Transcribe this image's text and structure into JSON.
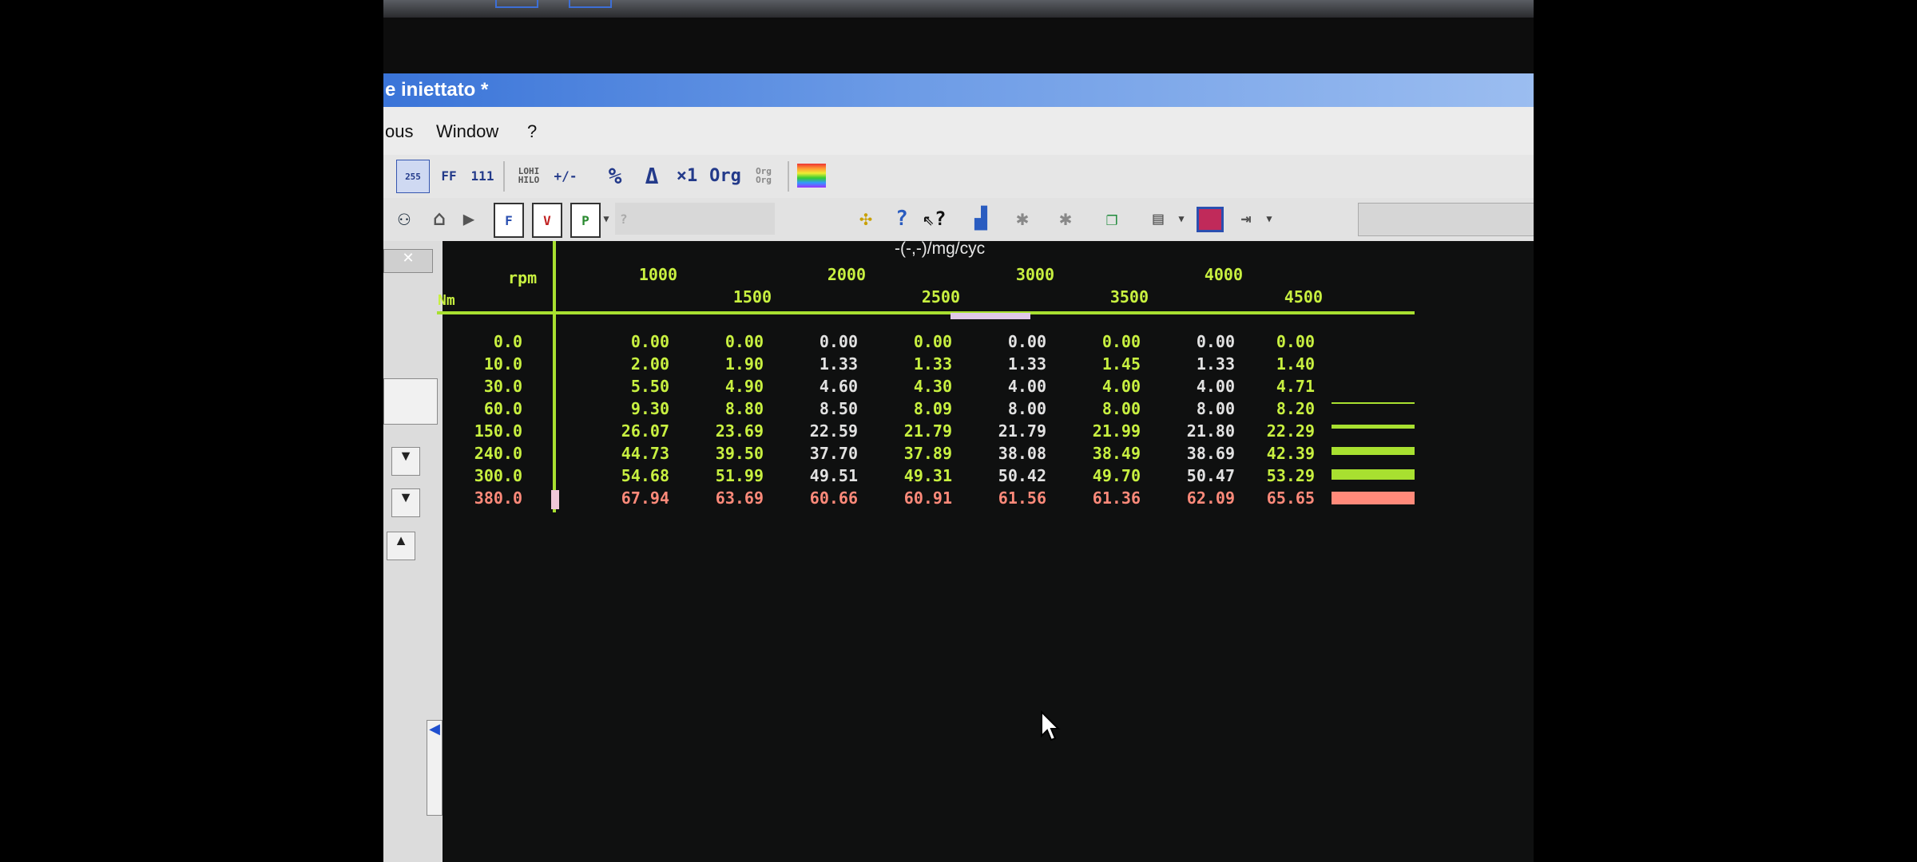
{
  "window": {
    "title": "e iniettato *"
  },
  "menu": {
    "items": [
      "ous",
      "Window",
      "?"
    ]
  },
  "toolbar1": {
    "buttons": [
      "255",
      "FF",
      "111",
      "LOHI HILO",
      "+/-",
      "%",
      "Δ",
      "×1",
      "Org",
      "Org Org",
      "rainbow"
    ]
  },
  "toolbar2": {
    "dropdown_placeholder": "?"
  },
  "table": {
    "unit": "-(-,-)/mg/cyc",
    "x_axis_label": "rpm",
    "y_axis_label": "Nm",
    "rpm": [
      "1000",
      "1500",
      "2000",
      "2500",
      "3000",
      "3500",
      "4000",
      "4500"
    ],
    "nm": [
      "0.0",
      "10.0",
      "30.0",
      "60.0",
      "150.0",
      "240.0",
      "300.0",
      "380.0"
    ],
    "rows": [
      [
        "0.00",
        "0.00",
        "0.00",
        "0.00",
        "0.00",
        "0.00",
        "0.00",
        "0.00"
      ],
      [
        "2.00",
        "1.90",
        "1.33",
        "1.33",
        "1.33",
        "1.45",
        "1.33",
        "1.40"
      ],
      [
        "5.50",
        "4.90",
        "4.60",
        "4.30",
        "4.00",
        "4.00",
        "4.00",
        "4.71"
      ],
      [
        "9.30",
        "8.80",
        "8.50",
        "8.09",
        "8.00",
        "8.00",
        "8.00",
        "8.20"
      ],
      [
        "26.07",
        "23.69",
        "22.59",
        "21.79",
        "21.79",
        "21.99",
        "21.80",
        "22.29"
      ],
      [
        "44.73",
        "39.50",
        "37.70",
        "37.89",
        "38.08",
        "38.49",
        "38.69",
        "42.39"
      ],
      [
        "54.68",
        "51.99",
        "49.51",
        "49.31",
        "50.42",
        "49.70",
        "50.47",
        "53.29"
      ],
      [
        "67.94",
        "63.69",
        "60.66",
        "60.91",
        "61.56",
        "61.36",
        "62.09",
        "65.65"
      ]
    ],
    "row_bar_levels": [
      0,
      0,
      0,
      0.05,
      0.34,
      0.65,
      0.81,
      1.0
    ],
    "colors": {
      "cell": "#c8f040",
      "selected_row": "#ff8a7a",
      "grid": "#a8e030"
    }
  }
}
